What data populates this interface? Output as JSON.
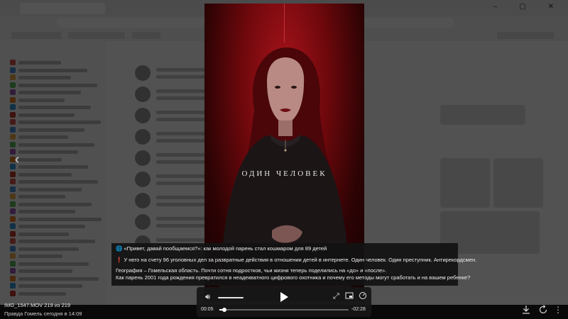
{
  "video": {
    "title_text": "ОДИН ЧЕЛОВЕК"
  },
  "caption": {
    "line1_icon": "🌐",
    "line1": "«Привет, давай пообщаемся?»: как молодой парень стал кошмаром для 89 детей",
    "line2_icon": "❗",
    "line2": "У него на счету 96 уголовных дел за развратные действия в отношении детей в интернете. Один человек. Один преступник. Антирекордсмен.",
    "line3": "География – Гомельская область. Почти сотня подростков, чьи жизни теперь поделились на «до» и «после».",
    "line4": "Как парень 2001 года рождения превратился в неадекватного цифрового охотника и почему его методы могут сработать и на вашем ребенке?"
  },
  "player": {
    "time_current": "00:05",
    "time_remaining": "-02:28",
    "progress": 0.04,
    "volume": 1.0,
    "icons": {
      "volume": "volume-icon",
      "play": "play-icon",
      "fullscreen": "fullscreen-icon",
      "pip": "picture-in-picture-icon",
      "speed": "playback-speed-icon"
    }
  },
  "file": {
    "name": "IMG_1547.MOV 219 из 219",
    "source": "Правда Гомель   сегодня в 14:09"
  },
  "nav": {
    "prev_icon": "chevron-left-icon"
  },
  "actions": {
    "download_icon": "download-icon",
    "rotate_icon": "rotate-icon",
    "more_icon": "more-vertical-icon"
  },
  "colors": {
    "video_red": "#8e0d12",
    "panel_dark": "#161616"
  }
}
